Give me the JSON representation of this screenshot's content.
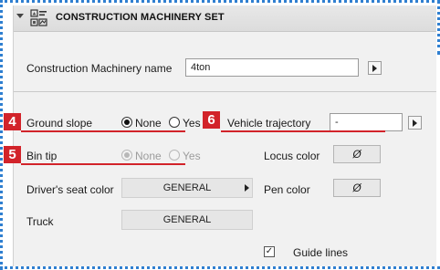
{
  "header": {
    "title": "CONSTRUCTION MACHINERY SET",
    "icon": "machinery-set-icon"
  },
  "machinery_name": {
    "label": "Construction Machinery name",
    "value": "4ton"
  },
  "ground_slope": {
    "label": "Ground slope",
    "options": [
      "None",
      "Yes"
    ],
    "selected": "None"
  },
  "vehicle_trajectory": {
    "label": "Vehicle trajectory",
    "value": "-"
  },
  "bin_tip": {
    "label": "Bin tip",
    "options": [
      "None",
      "Yes"
    ],
    "selected": "None",
    "disabled": true
  },
  "locus_color": {
    "label": "Locus color",
    "value": "Ø"
  },
  "drivers_seat_color": {
    "label": "Driver's seat color",
    "value": "GENERAL"
  },
  "pen_color": {
    "label": "Pen color",
    "value": "Ø"
  },
  "truck": {
    "label": "Truck",
    "value": "GENERAL"
  },
  "guide_lines": {
    "label": "Guide lines",
    "checked": true,
    "mark": "✓"
  },
  "callouts": {
    "four": "4",
    "five": "5",
    "six": "6"
  },
  "colors": {
    "accent_dots": "#2f7fd0",
    "callout_red": "#d2232a",
    "panel_bg": "#f1f1f1"
  }
}
